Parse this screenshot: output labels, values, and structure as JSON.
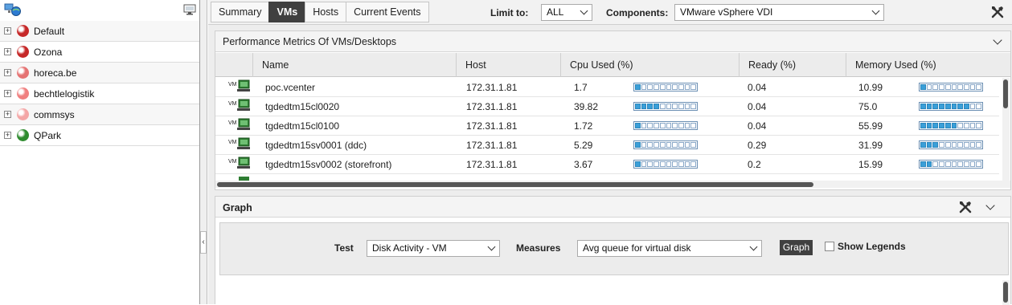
{
  "tree": {
    "items": [
      {
        "label": "Default",
        "color": "#c62828"
      },
      {
        "label": "Ozona",
        "color": "#c62828"
      },
      {
        "label": "horeca.be",
        "color": "#e57373"
      },
      {
        "label": "bechtlelogistik",
        "color": "#f08080"
      },
      {
        "label": "commsys",
        "color": "#f4a6a6"
      },
      {
        "label": "QPark",
        "color": "#2e8b2e"
      }
    ]
  },
  "tabs": [
    {
      "label": "Summary",
      "active": false
    },
    {
      "label": "VMs",
      "active": true
    },
    {
      "label": "Hosts",
      "active": false
    },
    {
      "label": "Current Events",
      "active": false
    }
  ],
  "filters": {
    "limit_label": "Limit to:",
    "limit_value": "ALL",
    "components_label": "Components:",
    "components_value": "VMware vSphere VDI"
  },
  "perf": {
    "title": "Performance Metrics Of VMs/Desktops",
    "columns": {
      "name": "Name",
      "host": "Host",
      "cpu": "Cpu Used (%)",
      "ready": "Ready (%)",
      "mem": "Memory Used (%)"
    },
    "rows": [
      {
        "name": "poc.vcenter",
        "host": "172.31.1.81",
        "cpu": "1.7",
        "ready": "0.04",
        "mem": "10.99"
      },
      {
        "name": "tgdedtm15cl0020",
        "host": "172.31.1.81",
        "cpu": "39.82",
        "ready": "0.04",
        "mem": "75.0"
      },
      {
        "name": "tgdedtm15cl0100",
        "host": "172.31.1.81",
        "cpu": "1.72",
        "ready": "0.04",
        "mem": "55.99"
      },
      {
        "name": "tgdedtm15sv0001 (ddc)",
        "host": "172.31.1.81",
        "cpu": "5.29",
        "ready": "0.29",
        "mem": "31.99"
      },
      {
        "name": "tgdedtm15sv0002 (storefront)",
        "host": "172.31.1.81",
        "cpu": "3.67",
        "ready": "0.2",
        "mem": "15.99"
      }
    ],
    "icon_label": "VM"
  },
  "graph": {
    "title": "Graph",
    "test_label": "Test",
    "test_value": "Disk Activity - VM",
    "measures_label": "Measures",
    "measures_value": "Avg queue for virtual disk",
    "button_label": "Graph",
    "legends_label": "Show Legends"
  },
  "colors": {
    "bar_fill": "#3a9fd8",
    "active_tab": "#404040"
  }
}
